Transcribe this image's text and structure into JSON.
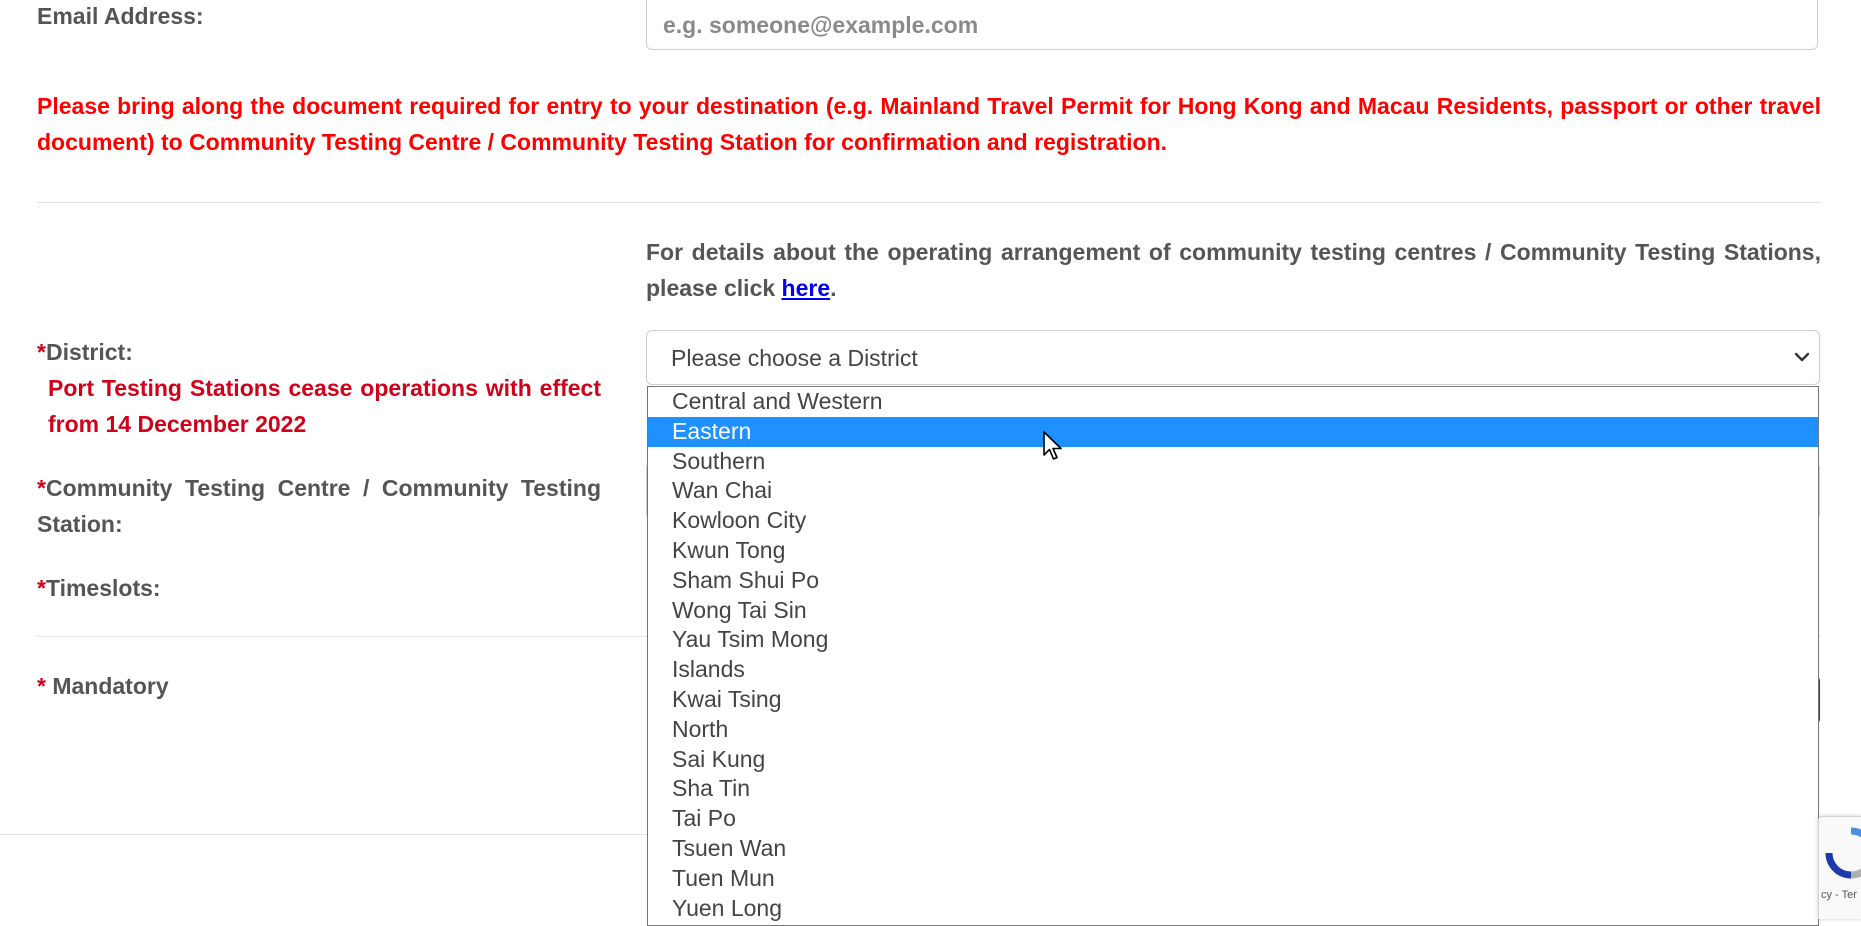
{
  "email": {
    "label": "Email Address:",
    "placeholder": "e.g. someone@example.com"
  },
  "warning_text": "Please bring along the document required for entry to your destination (e.g. Mainland Travel Permit for Hong Kong and Macau Residents, passport or other travel document) to Community Testing Centre / Community Testing Station for confirmation and registration.",
  "details": {
    "text_before": "For details about the operating arrangement of community testing centres / Community Testing Stations, please click ",
    "link_text": "here",
    "text_after": "."
  },
  "district": {
    "asterisk": "*",
    "label": "District:",
    "note": "Port Testing Stations cease operations with effect from 14 December 2022",
    "selected_text": "Please choose a District",
    "highlighted_option": "Eastern",
    "options": [
      "Central and Western",
      "Eastern",
      "Southern",
      "Wan Chai",
      "Kowloon City",
      "Kwun Tong",
      "Sham Shui Po",
      "Wong Tai Sin",
      "Yau Tsim Mong",
      "Islands",
      "Kwai Tsing",
      "North",
      "Sai Kung",
      "Sha Tin",
      "Tai Po",
      "Tsuen Wan",
      "Tuen Mun",
      "Yuen Long"
    ]
  },
  "centre": {
    "asterisk": "*",
    "label": "Community Testing Centre / Community Testing Station:"
  },
  "timeslots": {
    "asterisk": "*",
    "label": "Timeslots:"
  },
  "mandatory": {
    "asterisk": "*",
    "label": " Mandatory"
  },
  "recaptcha": {
    "partial_text": "cy - Ter"
  },
  "colors": {
    "warning": "#ff0000",
    "required": "#d0021b",
    "highlight": "#1e90ff",
    "link": "#0000ee",
    "label": "#555555"
  }
}
